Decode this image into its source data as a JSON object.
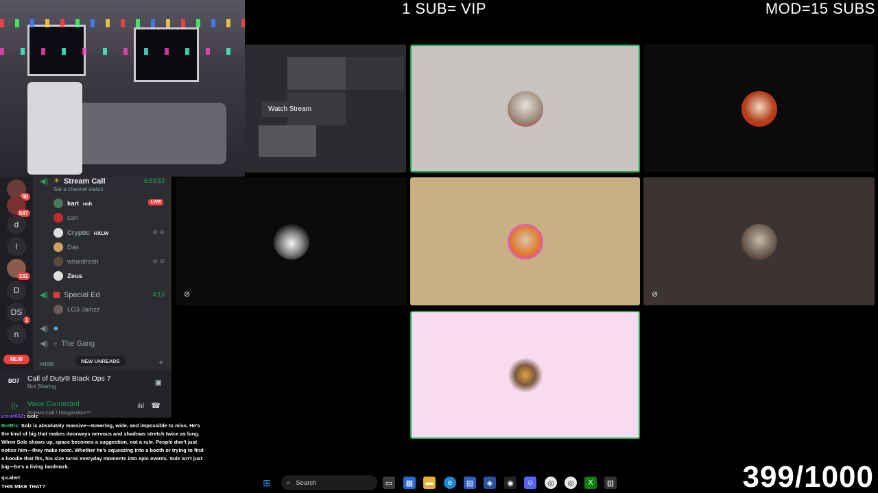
{
  "overlay": {
    "top_left_text": "1 SUB= VIP",
    "top_right_text": "MOD=15 SUBS",
    "counter": "399/1000"
  },
  "server_rail": {
    "items": [
      {
        "label": "",
        "badge": "98"
      },
      {
        "label": "",
        "badge": "547"
      },
      {
        "label": "d",
        "badge": ""
      },
      {
        "label": "l",
        "badge": ""
      },
      {
        "label": "",
        "badge": "332"
      },
      {
        "label": "D",
        "badge": ""
      },
      {
        "label": "DS",
        "badge": "1"
      },
      {
        "label": "n",
        "badge": ""
      }
    ],
    "new_label": "NEW"
  },
  "channels": {
    "stream_call": {
      "name": "Stream Call",
      "time": "6:53:53",
      "status": "Set a channel status",
      "users": [
        {
          "name": "kari",
          "tag": "nah",
          "live": "LIVE"
        },
        {
          "name": "carl"
        },
        {
          "name": "Cryptic",
          "tag": "HXLW"
        },
        {
          "name": "Das"
        },
        {
          "name": "whoisfresh"
        },
        {
          "name": "Zeus"
        }
      ]
    },
    "special_ed": {
      "name": "Special Ed",
      "time": "4:13",
      "users": [
        {
          "name": "LG3 Jaihzz"
        }
      ]
    },
    "the_gang": {
      "name": "The Gang"
    },
    "edate_label": "edate",
    "new_unreads": "NEW UNREADS"
  },
  "activity": {
    "title": "Call of Duty® Black Ops 7",
    "subtitle": "Not Sharing",
    "icon_text": "BO7"
  },
  "voice": {
    "title": "Voice Connected",
    "subtitle": "Stream Call / Dasgasdom™"
  },
  "chat": [
    {
      "user": "josue662",
      "text": ": isolz"
    },
    {
      "user": "BotRix",
      "text": ": Solz is absolutely massive—towering, wide, and impossible to miss. He's the kind of big that makes doorways nervous and shadows stretch twice as long. When Solz shows up, space becomes a suggestion, not a rule. People don't just notice him—they make room. Whether he's squeezing into a booth or trying to find a hoodie that fits, his size turns everyday moments into epic events. Solz isn't just big—he's a living landmark."
    },
    {
      "user": "",
      "text": "qu.alert"
    },
    {
      "user": "",
      "text": "THIS MIKE THAT?"
    }
  ],
  "grid": {
    "watch_stream_label": "Watch Stream"
  },
  "taskbar": {
    "search_placeholder": "Search"
  },
  "colors": {
    "discord_green": "#23a55a",
    "discord_red": "#f23f43",
    "speaking_border": "#23a55a"
  }
}
